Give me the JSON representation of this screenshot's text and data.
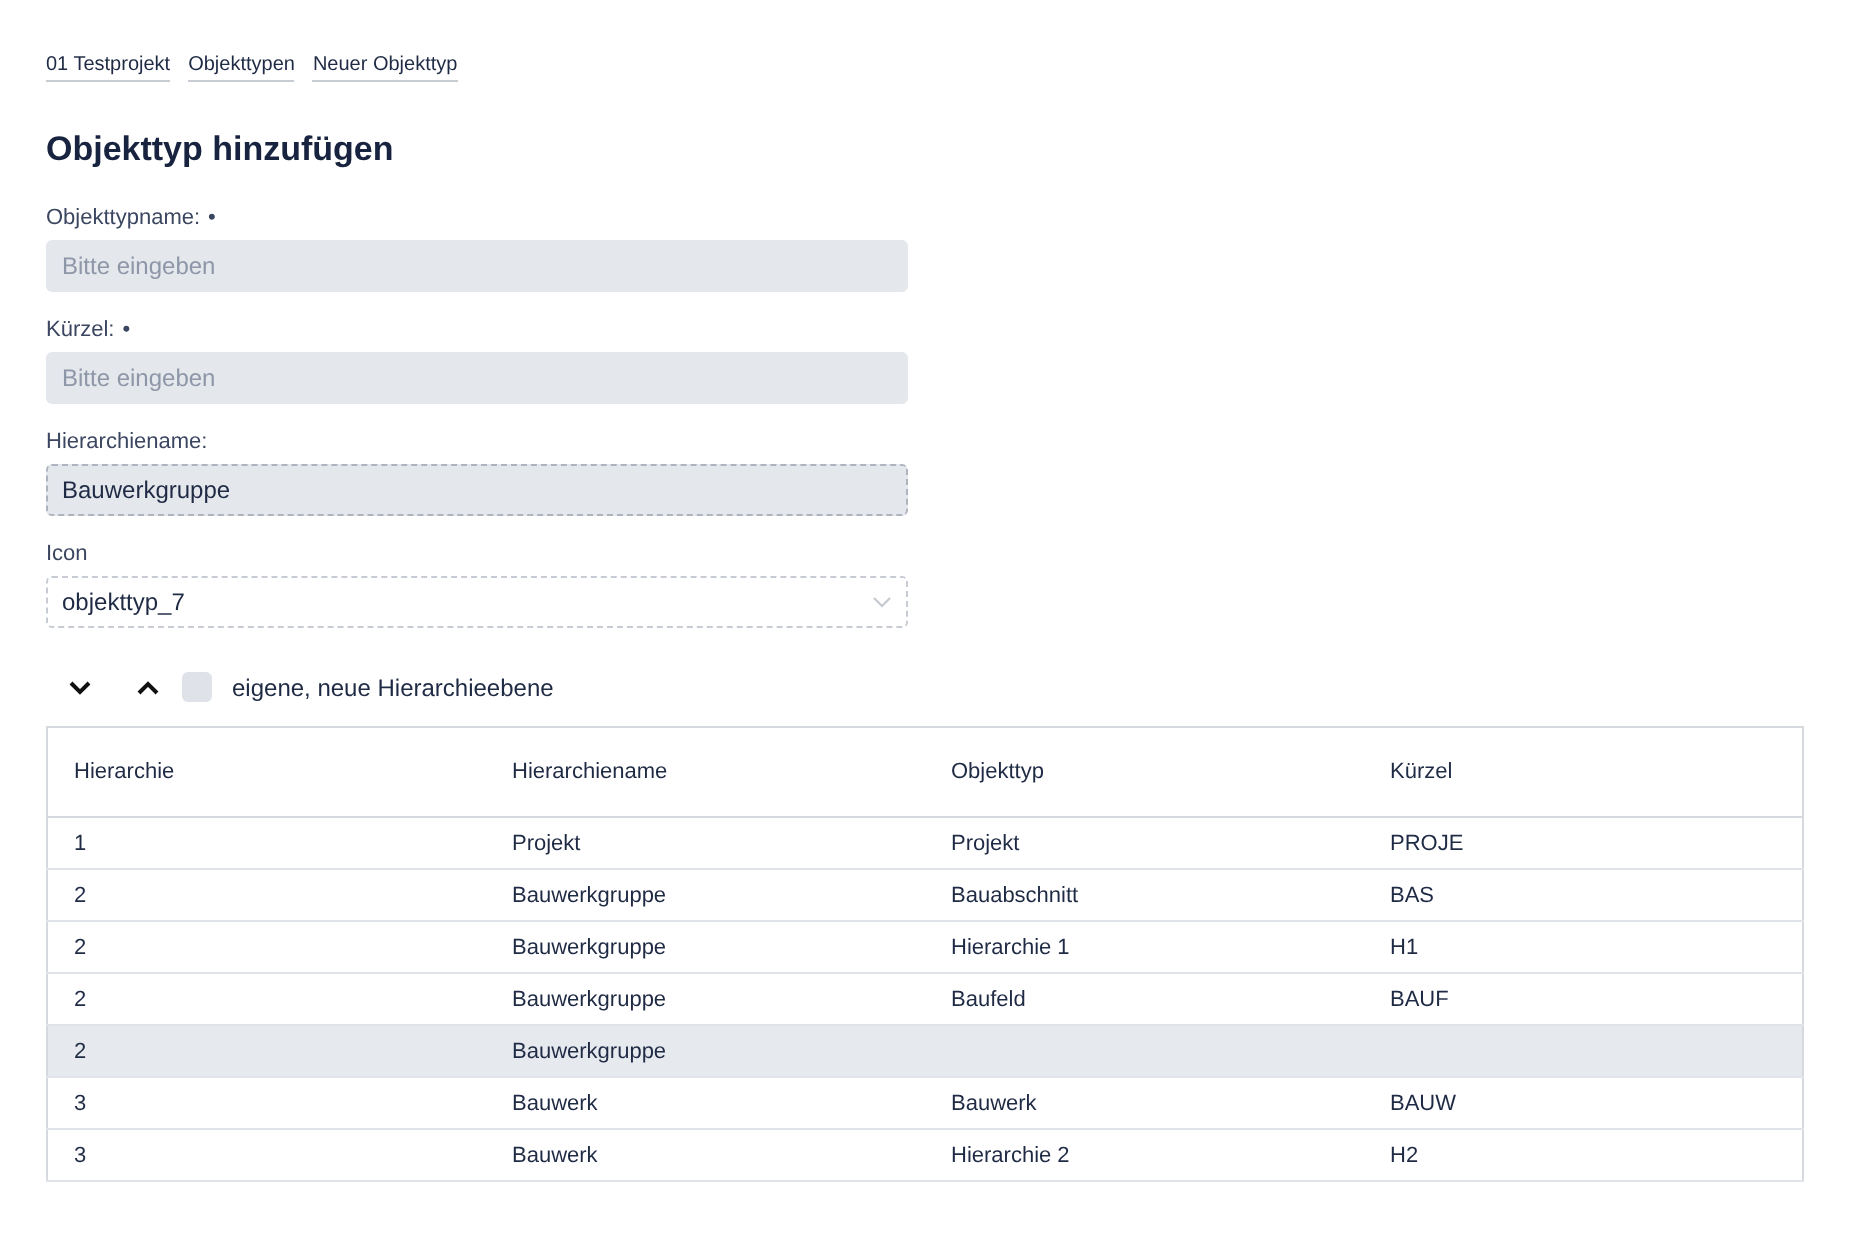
{
  "breadcrumbs": [
    "01 Testprojekt",
    "Objekttypen",
    "Neuer Objekttyp"
  ],
  "title": "Objekttyp hinzufügen",
  "fields": [
    {
      "kind": "text",
      "label": "Objekttypname:",
      "required_mark": "•",
      "placeholder": "Bitte eingeben",
      "readonly": false
    },
    {
      "kind": "text",
      "label": "Kürzel:",
      "required_mark": "•",
      "placeholder": "Bitte eingeben",
      "readonly": false
    },
    {
      "kind": "text",
      "label": "Hierarchiename:",
      "value": "Bauwerkgruppe",
      "readonly": true
    },
    {
      "kind": "select",
      "label": "Icon",
      "value": "objekttyp_7"
    }
  ],
  "hierarchy_toolbar": {
    "checkbox": {
      "label": "eigene, neue Hierarchieebene",
      "checked": false
    }
  },
  "table": {
    "columns": [
      "Hierarchie",
      "Hierarchiename",
      "Objekttyp",
      "Kürzel"
    ],
    "rows": [
      {
        "cells": [
          "1",
          "Projekt",
          "Projekt",
          "PROJE"
        ],
        "selected": false
      },
      {
        "cells": [
          "2",
          "Bauwerkgruppe",
          "Bauabschnitt",
          "BAS"
        ],
        "selected": false
      },
      {
        "cells": [
          "2",
          "Bauwerkgruppe",
          "Hierarchie 1",
          "H1"
        ],
        "selected": false
      },
      {
        "cells": [
          "2",
          "Bauwerkgruppe",
          "Baufeld",
          "BAUF"
        ],
        "selected": false
      },
      {
        "cells": [
          "2",
          "Bauwerkgruppe"
        ],
        "selected": true
      },
      {
        "cells": [
          "3",
          "Bauwerk",
          "Bauwerk",
          "BAUW"
        ],
        "selected": false
      },
      {
        "cells": [
          "3",
          "Bauwerk",
          "Hierarchie 2",
          "H2"
        ],
        "selected": false
      }
    ]
  }
}
